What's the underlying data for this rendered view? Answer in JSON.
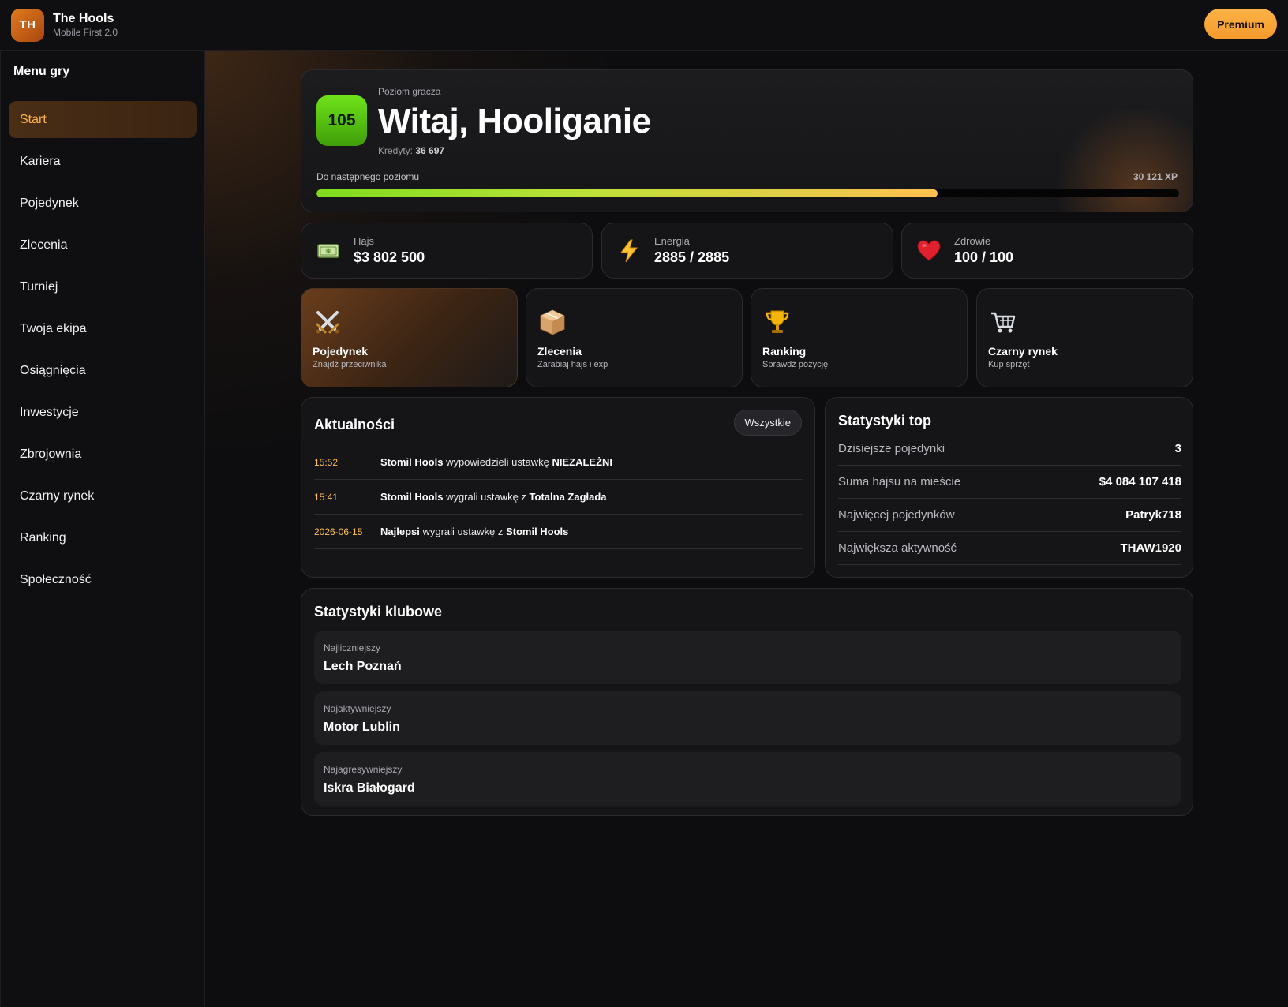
{
  "header": {
    "logo_text": "TH",
    "title": "The Hools",
    "subtitle": "Mobile First 2.0",
    "premium_label": "Premium"
  },
  "sidebar": {
    "title": "Menu gry",
    "items": [
      {
        "label": "Start",
        "active": true
      },
      {
        "label": "Kariera"
      },
      {
        "label": "Pojedynek"
      },
      {
        "label": "Zlecenia"
      },
      {
        "label": "Turniej"
      },
      {
        "label": "Twoja ekipa"
      },
      {
        "label": "Osiągnięcia"
      },
      {
        "label": "Inwestycje"
      },
      {
        "label": "Zbrojownia"
      },
      {
        "label": "Czarny rynek"
      },
      {
        "label": "Ranking"
      },
      {
        "label": "Społeczność"
      }
    ]
  },
  "hero": {
    "level": "105",
    "level_label": "Poziom gracza",
    "greeting": "Witaj, Hooliganie",
    "credits_label": "Kredyty:",
    "credits_value": "36 697",
    "next_level_label": "Do następnego poziomu",
    "xp_value": "30 121 XP",
    "xp_progress": 0.72
  },
  "stats": [
    {
      "label": "Hajs",
      "value": "$3 802 500",
      "icon": "money-icon"
    },
    {
      "label": "Energia",
      "value": "2885 / 2885",
      "icon": "lightning-icon"
    },
    {
      "label": "Zdrowie",
      "value": "100 / 100",
      "icon": "heart-icon"
    }
  ],
  "tiles": [
    {
      "title": "Pojedynek",
      "subtitle": "Znajdź przeciwnika",
      "icon": "crossed-swords-icon",
      "active": true
    },
    {
      "title": "Zlecenia",
      "subtitle": "Zarabiaj hajs i exp",
      "icon": "package-icon"
    },
    {
      "title": "Ranking",
      "subtitle": "Sprawdź pozycję",
      "icon": "trophy-icon"
    },
    {
      "title": "Czarny rynek",
      "subtitle": "Kup sprzęt",
      "icon": "cart-icon"
    }
  ],
  "news": {
    "title": "Aktualności",
    "all_label": "Wszystkie",
    "items": [
      {
        "time": "15:52",
        "a": "Stomil Hools",
        "mid": " wypowiedzieli ustawkę ",
        "b": "NIEZALEŻNI"
      },
      {
        "time": "15:41",
        "a": "Stomil Hools",
        "mid": " wygrali ustawkę z ",
        "b": "Totalna Zagłada"
      },
      {
        "time": "2026-06-15",
        "a": "Najlepsi",
        "mid": " wygrali ustawkę z ",
        "b": "Stomil Hools"
      }
    ]
  },
  "top_stats": {
    "title": "Statystyki top",
    "rows": [
      {
        "label": "Dzisiejsze pojedynki",
        "value": "3"
      },
      {
        "label": "Suma hajsu na mieście",
        "value": "$4 084 107 418"
      },
      {
        "label": "Najwięcej pojedynków",
        "value": "Patryk718"
      },
      {
        "label": "Największa aktywność",
        "value": "THAW1920"
      }
    ]
  },
  "club_stats": {
    "title": "Statystyki klubowe",
    "items": [
      {
        "label": "Najliczniejszy",
        "value": "Lech Poznań"
      },
      {
        "label": "Najaktywniejszy",
        "value": "Motor Lublin"
      },
      {
        "label": "Najagresywniejszy",
        "value": "Iskra Białogard"
      }
    ]
  },
  "colors": {
    "accent": "#ffb547",
    "level_green": "#5ccb12",
    "background": "#0d0d0f",
    "card": "#151517"
  }
}
